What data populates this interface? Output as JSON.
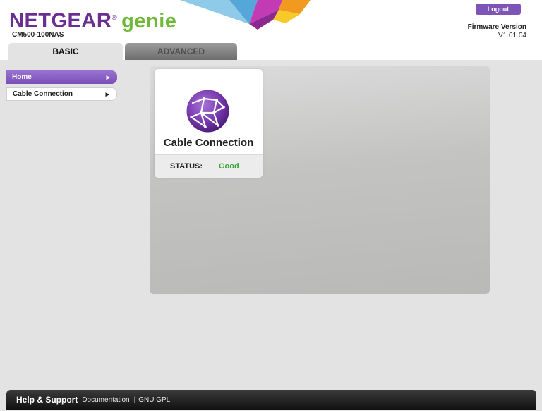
{
  "header": {
    "brand_netgear": "NETGEAR",
    "brand_reg": "®",
    "brand_genie": "genie",
    "model": "CM500-100NAS",
    "logout_label": "Logout",
    "firmware_label": "Firmware Version",
    "firmware_value": "V1.01.04",
    "accent_color": "#6a2f90",
    "genie_color": "#6fb83a"
  },
  "tabs": [
    {
      "label": "BASIC",
      "active": true
    },
    {
      "label": "ADVANCED",
      "active": false
    }
  ],
  "sidebar": {
    "items": [
      {
        "label": "Home",
        "arrow": "▶",
        "active": true
      },
      {
        "label": "Cable Connection",
        "arrow": "▶",
        "active": false
      }
    ]
  },
  "main": {
    "card": {
      "icon": "globe-icon",
      "title": "Cable Connection",
      "status_label": "STATUS:",
      "status_value": "Good",
      "status_color": "#3aa53c"
    }
  },
  "footer": {
    "title": "Help & Support",
    "link_documentation": "Documentation",
    "separator": "|",
    "link_gpl": "GNU GPL"
  }
}
